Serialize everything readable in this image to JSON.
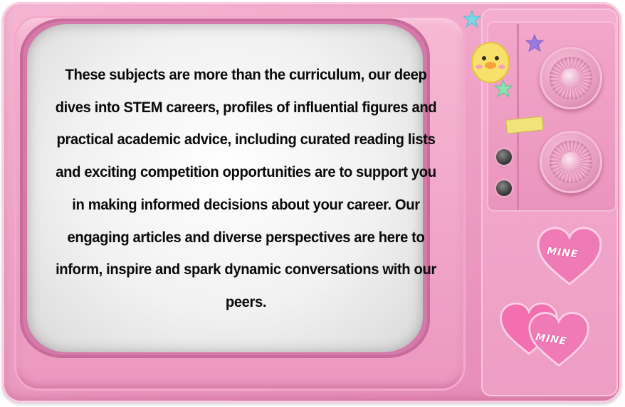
{
  "screen": {
    "text": "These subjects are more than the curriculum, our deep dives into STEM careers, profiles of influential figures and practical academic advice, including curated reading lists and exciting competition opportunities are to support you in making informed decisions about your career. Our engaging articles and diverse perspectives are here to inform, inspire and spark dynamic conversations with our peers."
  },
  "stickers": {
    "heart_1": "MINE",
    "heart_2": "MINE"
  },
  "icons": [
    "star-icon",
    "duck-face-sticker-icon",
    "heart-sticker-icon",
    "tuning-knob-icon"
  ],
  "colors": {
    "tv_body": "#ee9dc3",
    "screen": "#f1f1f1",
    "text": "#0a0a0a"
  }
}
